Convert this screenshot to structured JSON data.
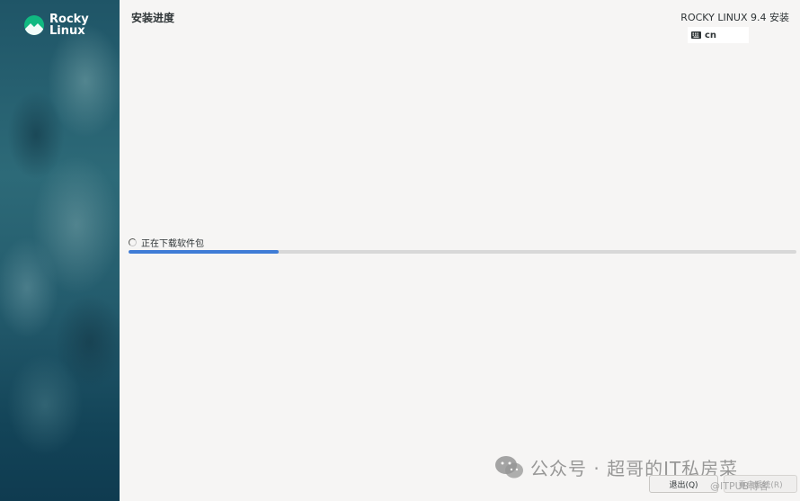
{
  "sidebar": {
    "logo_text": "Rocky Linux",
    "colors": {
      "logo_green": "#10b981",
      "sidebar_bg": "#1f5567"
    }
  },
  "header": {
    "page_title": "安装进度",
    "product_title": "ROCKY LINUX 9.4 安装",
    "keyboard": {
      "icon": "keyboard-icon",
      "layout": "cn"
    }
  },
  "progress": {
    "status_text": "正在下载软件包",
    "spinner_icon": "spinner-icon",
    "fraction": 0.225,
    "accent_color": "#3f7cd6"
  },
  "footer": {
    "quit_label": "退出(Q)",
    "reboot_label": "重启系统(R)"
  },
  "watermark": {
    "icon": "wechat-icon",
    "text": "公众号 · 超哥的IT私房菜",
    "sub_text": "@ITPUB博客"
  }
}
